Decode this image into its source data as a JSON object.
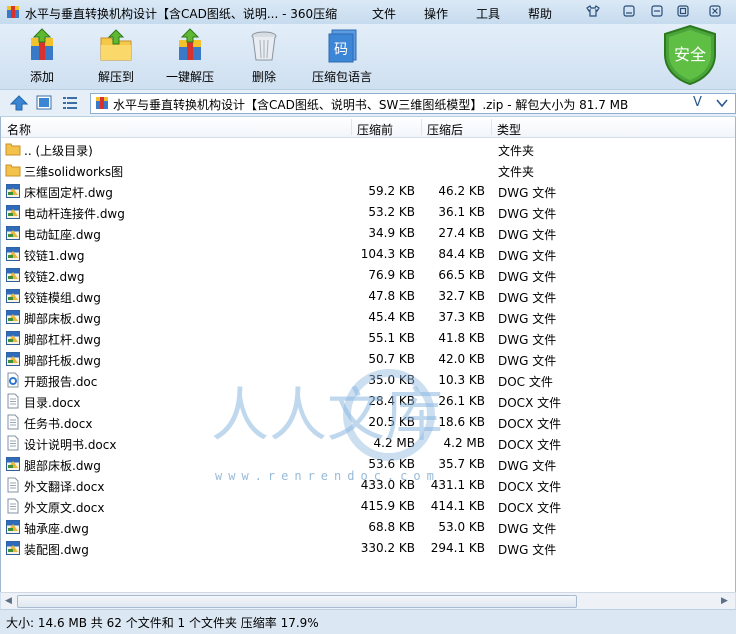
{
  "window": {
    "title": "水平与垂直转换机构设计【含CAD图纸、说明... - 360压缩",
    "menu": [
      "文件",
      "操作",
      "工具",
      "帮助"
    ]
  },
  "toolbar": {
    "buttons": [
      {
        "label": "添加",
        "icon": "add-icon"
      },
      {
        "label": "解压到",
        "icon": "extract-to-icon"
      },
      {
        "label": "一键解压",
        "icon": "one-click-extract-icon"
      },
      {
        "label": "删除",
        "icon": "delete-icon"
      },
      {
        "label": "压缩包语言",
        "icon": "archive-language-icon"
      }
    ],
    "security_label": "安全",
    "language_glyph": "码"
  },
  "address": {
    "path": "水平与垂直转换机构设计【含CAD图纸、说明书、SW三维图纸模型】.zip - 解包大小为 81.7 MB",
    "dropdown": "V"
  },
  "columns": {
    "name": "名称",
    "compressed": "压缩前",
    "packed": "压缩后",
    "type": "类型"
  },
  "files": [
    {
      "name": ".. (上级目录)",
      "before": "",
      "after": "",
      "type": "文件夹",
      "kind": "folder"
    },
    {
      "name": "三维solidworks图",
      "before": "",
      "after": "",
      "type": "文件夹",
      "kind": "folder"
    },
    {
      "name": "床框固定杆.dwg",
      "before": "59.2 KB",
      "after": "46.2 KB",
      "type": "DWG 文件",
      "kind": "dwg"
    },
    {
      "name": "电动杆连接件.dwg",
      "before": "53.2 KB",
      "after": "36.1 KB",
      "type": "DWG 文件",
      "kind": "dwg"
    },
    {
      "name": "电动缸座.dwg",
      "before": "34.9 KB",
      "after": "27.4 KB",
      "type": "DWG 文件",
      "kind": "dwg"
    },
    {
      "name": "铰链1.dwg",
      "before": "104.3 KB",
      "after": "84.4 KB",
      "type": "DWG 文件",
      "kind": "dwg"
    },
    {
      "name": "铰链2.dwg",
      "before": "76.9 KB",
      "after": "66.5 KB",
      "type": "DWG 文件",
      "kind": "dwg"
    },
    {
      "name": "铰链模组.dwg",
      "before": "47.8 KB",
      "after": "32.7 KB",
      "type": "DWG 文件",
      "kind": "dwg"
    },
    {
      "name": "脚部床板.dwg",
      "before": "45.4 KB",
      "after": "37.3 KB",
      "type": "DWG 文件",
      "kind": "dwg"
    },
    {
      "name": "脚部杠杆.dwg",
      "before": "55.1 KB",
      "after": "41.8 KB",
      "type": "DWG 文件",
      "kind": "dwg"
    },
    {
      "name": "脚部托板.dwg",
      "before": "50.7 KB",
      "after": "42.0 KB",
      "type": "DWG 文件",
      "kind": "dwg"
    },
    {
      "name": "开题报告.doc",
      "before": "35.0 KB",
      "after": "10.3 KB",
      "type": "DOC 文件",
      "kind": "doc"
    },
    {
      "name": "目录.docx",
      "before": "28.4 KB",
      "after": "26.1 KB",
      "type": "DOCX 文件",
      "kind": "docx"
    },
    {
      "name": "任务书.docx",
      "before": "20.5 KB",
      "after": "18.6 KB",
      "type": "DOCX 文件",
      "kind": "docx"
    },
    {
      "name": "设计说明书.docx",
      "before": "4.2 MB",
      "after": "4.2 MB",
      "type": "DOCX 文件",
      "kind": "docx"
    },
    {
      "name": "腿部床板.dwg",
      "before": "53.6 KB",
      "after": "35.7 KB",
      "type": "DWG 文件",
      "kind": "dwg"
    },
    {
      "name": "外文翻译.docx",
      "before": "433.0 KB",
      "after": "431.1 KB",
      "type": "DOCX 文件",
      "kind": "docx"
    },
    {
      "name": "外文原文.docx",
      "before": "415.9 KB",
      "after": "414.1 KB",
      "type": "DOCX 文件",
      "kind": "docx"
    },
    {
      "name": "轴承座.dwg",
      "before": "68.8 KB",
      "after": "53.0 KB",
      "type": "DWG 文件",
      "kind": "dwg"
    },
    {
      "name": "装配图.dwg",
      "before": "330.2 KB",
      "after": "294.1 KB",
      "type": "DWG 文件",
      "kind": "dwg"
    }
  ],
  "status": "大小: 14.6 MB 共 62 个文件和 1 个文件夹 压缩率 17.9%",
  "watermark": {
    "text": "人人文库",
    "url": "www.renrendoc.com"
  }
}
